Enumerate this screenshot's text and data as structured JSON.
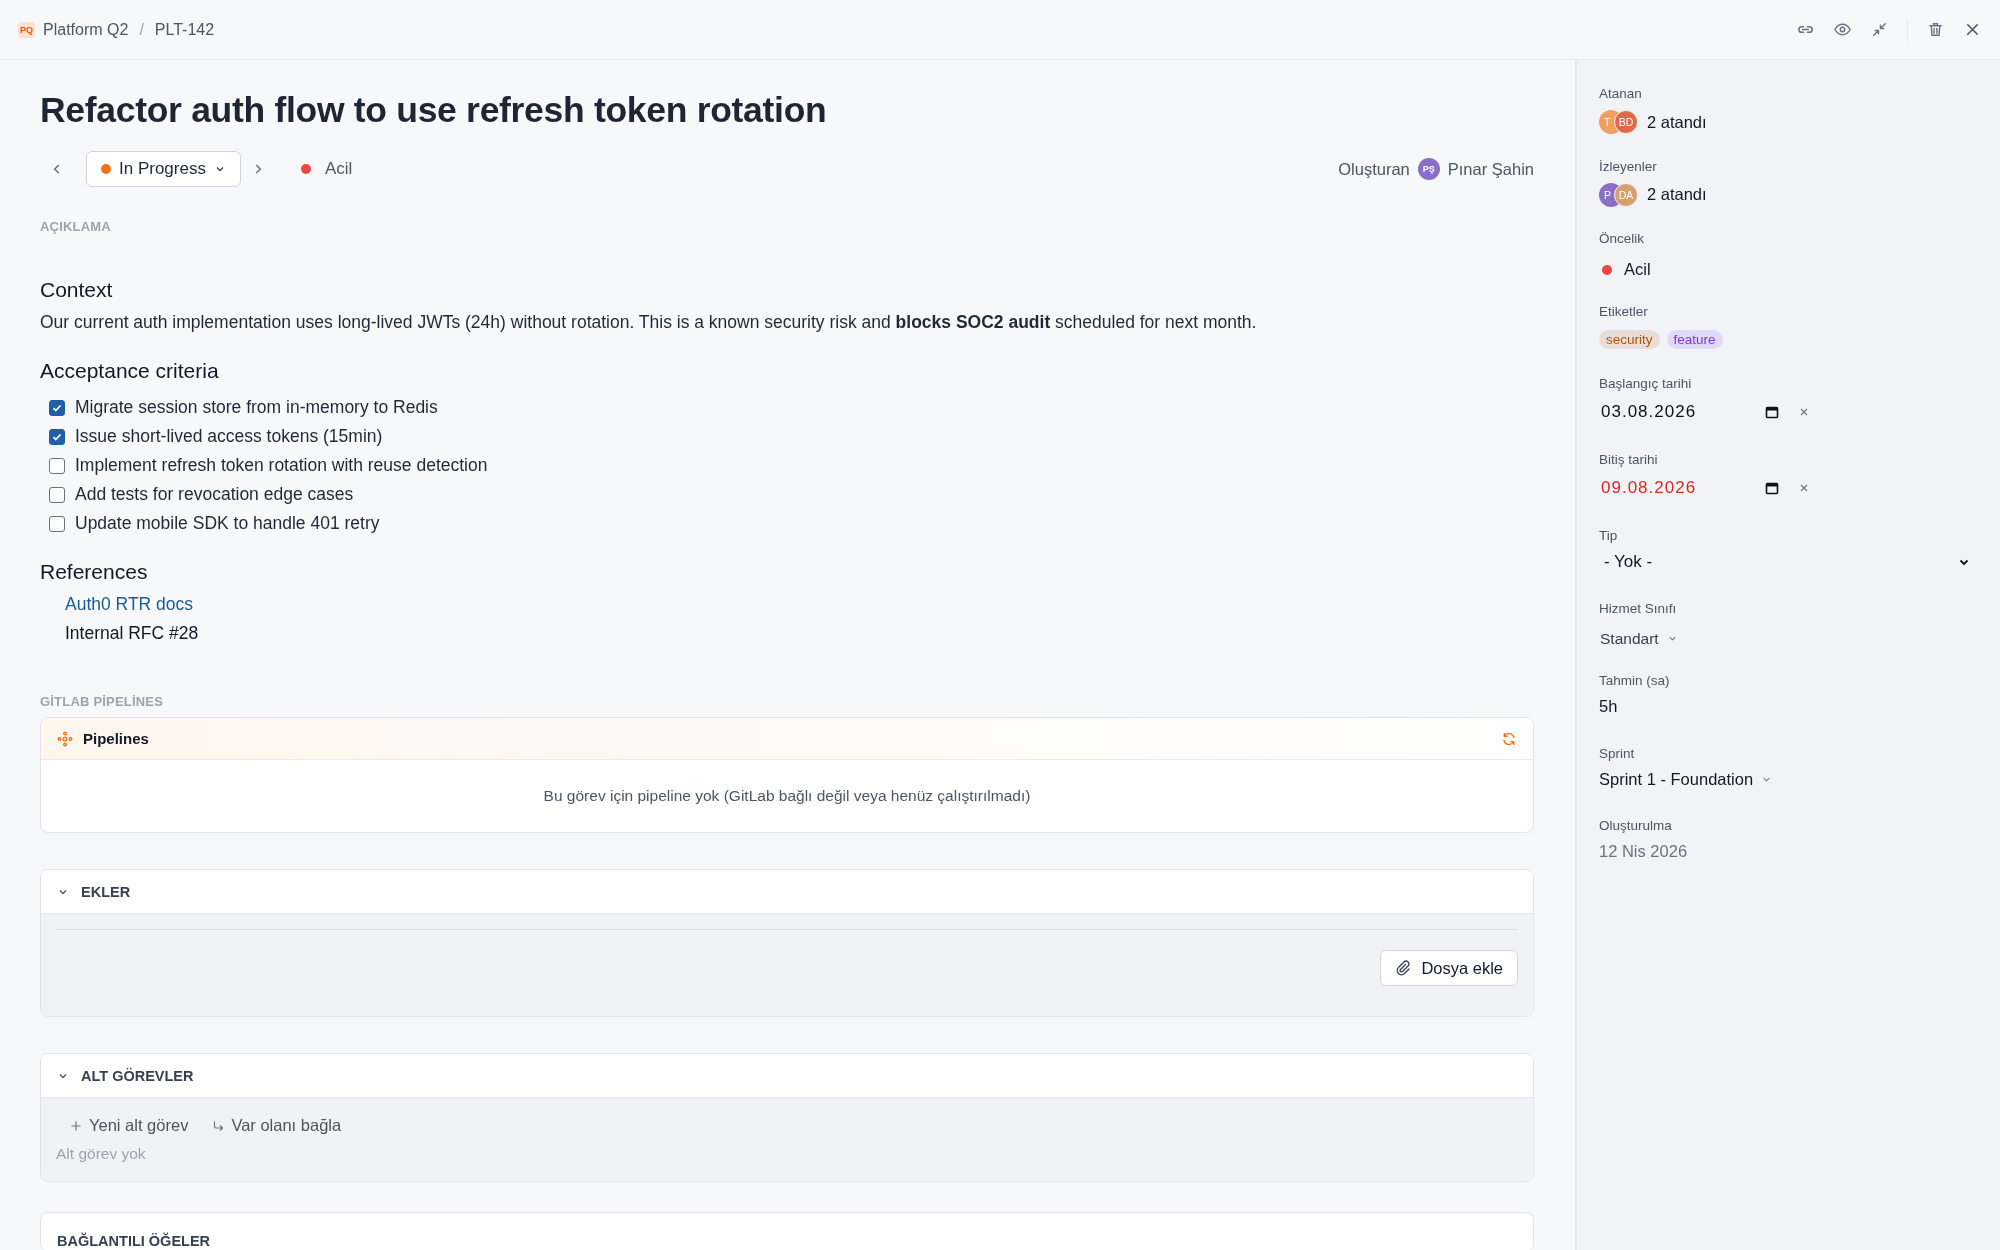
{
  "breadcrumb": {
    "project_badge": "PQ",
    "project": "Platform Q2",
    "separator": "/",
    "issue_key": "PLT-142"
  },
  "title": "Refactor auth flow to use refresh token rotation",
  "status": {
    "label": "In Progress",
    "color": "#f97316"
  },
  "priority": {
    "label": "Acil",
    "color": "#ef4444"
  },
  "creator": {
    "label": "Oluşturan",
    "initials": "PŞ",
    "name": "Pınar Şahin",
    "color": "#8b6fc6"
  },
  "description": {
    "label": "AÇIKLAMA",
    "blocks": [
      {
        "kind": "heading",
        "text": "Context"
      },
      {
        "kind": "paragraph",
        "text": "Our current auth implementation uses long-lived JWTs (24h) without rotation. This is a known security risk and **blocks SOC2 audit** scheduled for next month."
      },
      {
        "kind": "heading",
        "text": "Acceptance criteria"
      },
      {
        "kind": "checklist",
        "items": [
          {
            "text": "Migrate session store from in-memory to Redis",
            "checked": true
          },
          {
            "text": "Issue short-lived access tokens (15min)",
            "checked": true
          },
          {
            "text": "Implement refresh token rotation with reuse detection",
            "checked": false
          },
          {
            "text": "Add tests for revocation edge cases",
            "checked": false
          },
          {
            "text": "Update mobile SDK to handle 401 retry",
            "checked": false
          }
        ]
      },
      {
        "kind": "heading",
        "text": "References"
      },
      {
        "kind": "links",
        "items": [
          {
            "text": "Auth0 RTR docs",
            "link": true
          },
          {
            "text": "Internal RFC #28",
            "link": false
          }
        ]
      }
    ]
  },
  "pipelines": {
    "section_label": "GİTLAB PİPELİNES",
    "title": "Pipelines",
    "empty_text": "Bu görev için pipeline yok (GitLab bağlı değil veya henüz çalıştırılmadı)"
  },
  "attachments": {
    "title": "EKLER",
    "expanded": true,
    "button": "Dosya ekle"
  },
  "subtasks": {
    "title": "ALT GÖREVLER",
    "expanded": true,
    "actions": [
      {
        "kind": "new",
        "label": "Yeni alt görev"
      },
      {
        "kind": "link",
        "label": "Var olanı bağla"
      }
    ],
    "empty_text": "Alt görev yok"
  },
  "linked_items": {
    "title": "BAĞLANTILI ÖĞELER"
  },
  "sidebar": [
    {
      "kind": "avatars",
      "label": "Atanan",
      "avatars": [
        {
          "initials": "T",
          "color": "#f0a060"
        },
        {
          "initials": "BD",
          "color": "#e06a48"
        }
      ],
      "value": "2 atandı"
    },
    {
      "kind": "avatars",
      "label": "İzleyenler",
      "avatars": [
        {
          "initials": "P",
          "color": "#8b6fc6"
        },
        {
          "initials": "DA",
          "color": "#d4a070"
        }
      ],
      "value": "2 atandı"
    },
    {
      "kind": "priority",
      "label": "Öncelik",
      "value": "Acil",
      "color": "#ef4444"
    },
    {
      "kind": "tags",
      "label": "Etiketler",
      "tags": [
        {
          "text": "security",
          "color": "#b45309"
        },
        {
          "text": "feature",
          "color": "#7c3aed"
        }
      ]
    },
    {
      "kind": "date",
      "label": "Başlangıç tarihi",
      "value": "03.08.2026",
      "overdue": false
    },
    {
      "kind": "date",
      "label": "Bitiş tarihi",
      "value": "09.08.2026",
      "overdue": true
    },
    {
      "kind": "select",
      "label": "Tip",
      "value": "- Yok -"
    },
    {
      "kind": "dropdown",
      "label": "Hizmet Sınıfı",
      "value": "Standart"
    },
    {
      "kind": "text",
      "label": "Tahmin (sa)",
      "value": "5h"
    },
    {
      "kind": "dropdown",
      "label": "Sprint",
      "value": "Sprint 1 - Foundation"
    },
    {
      "kind": "muted",
      "label": "Oluşturulma",
      "value": "12 Nis 2026"
    }
  ]
}
